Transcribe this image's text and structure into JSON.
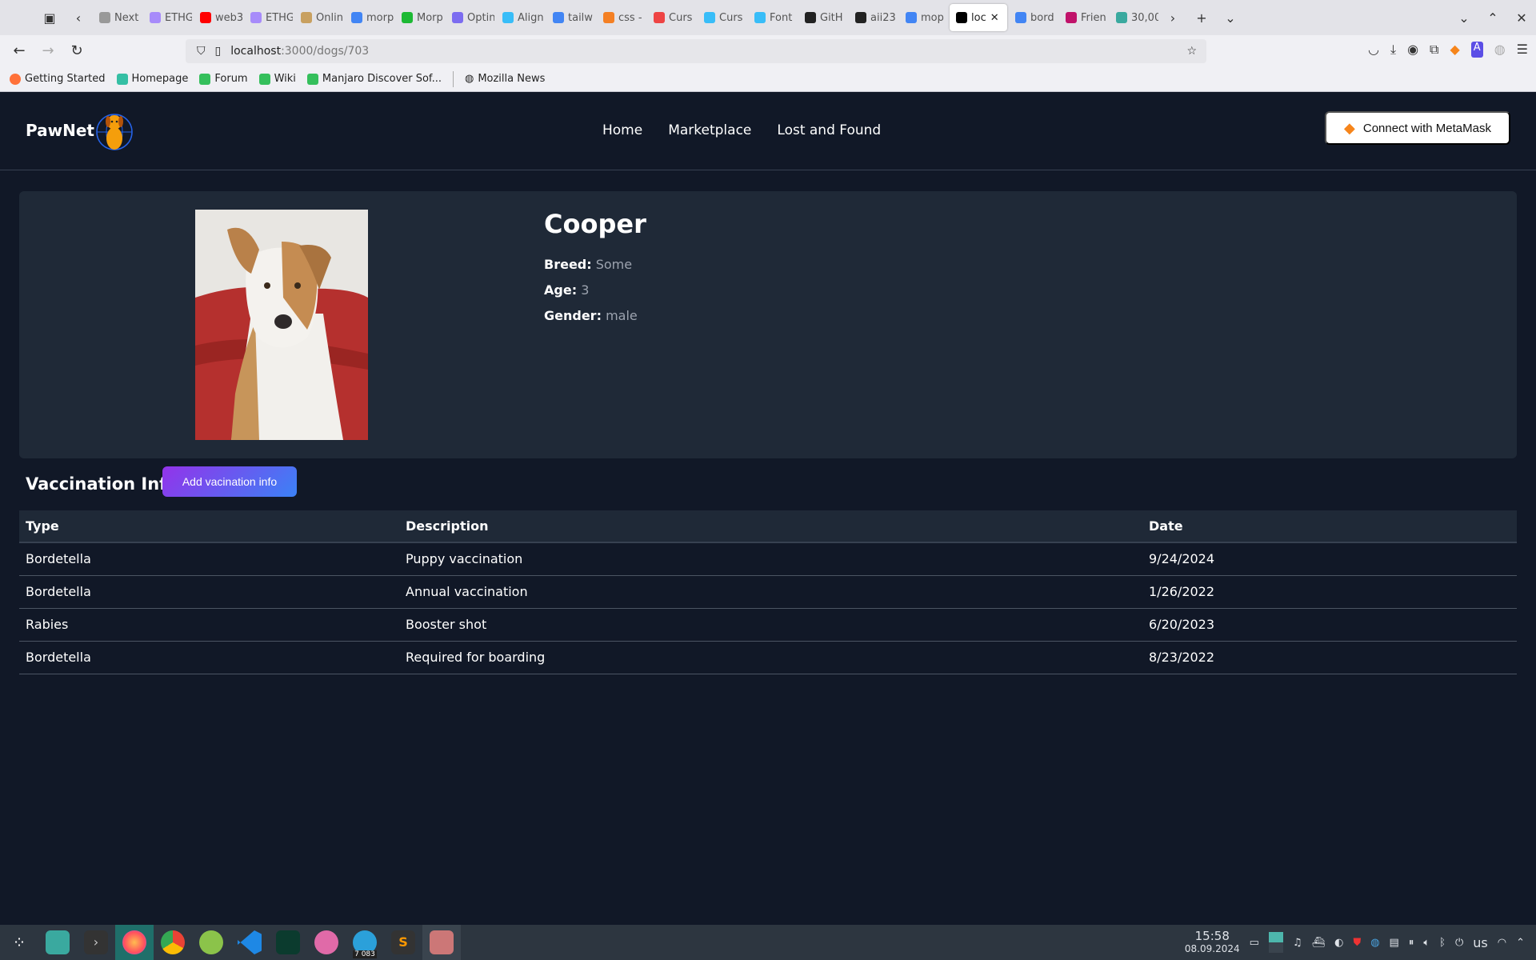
{
  "browser": {
    "tabs": [
      {
        "label": "Next",
        "color": "#999"
      },
      {
        "label": "ETHG",
        "color": "#a78bfa"
      },
      {
        "label": "web3",
        "color": "#ff0000"
      },
      {
        "label": "ETHG",
        "color": "#a78bfa"
      },
      {
        "label": "Onlin",
        "color": "#c8a060"
      },
      {
        "label": "morp",
        "color": "#4285f4"
      },
      {
        "label": "Morp",
        "color": "#1db934"
      },
      {
        "label": "Optin",
        "color": "#7c6cf0"
      },
      {
        "label": "Align",
        "color": "#38bdf8"
      },
      {
        "label": "tailw",
        "color": "#4285f4"
      },
      {
        "label": "css -",
        "color": "#f48024"
      },
      {
        "label": "Curs",
        "color": "#e44"
      },
      {
        "label": "Curs",
        "color": "#38bdf8"
      },
      {
        "label": "Font",
        "color": "#38bdf8"
      },
      {
        "label": "GitH",
        "color": "#222"
      },
      {
        "label": "aii23",
        "color": "#222"
      },
      {
        "label": "mop",
        "color": "#4285f4"
      },
      {
        "label": "loc",
        "color": "#000",
        "active": true
      },
      {
        "label": "bord",
        "color": "#4285f4"
      },
      {
        "label": "Frien",
        "color": "#c0126a"
      },
      {
        "label": "30,00",
        "color": "#3aa99f"
      }
    ],
    "url_host": "localhost",
    "url_path": ":3000/dogs/703",
    "bookmarks": [
      "Getting Started",
      "Homepage",
      "Forum",
      "Wiki",
      "Manjaro Discover Sof...",
      "Mozilla News"
    ]
  },
  "navbar": {
    "logo": "PawNet",
    "links": [
      "Home",
      "Marketplace",
      "Lost and Found"
    ],
    "connect_label": "Connect with MetaMask"
  },
  "dog": {
    "name": "Cooper",
    "breed_label": "Breed:",
    "breed": "Some",
    "age_label": "Age:",
    "age": "3",
    "gender_label": "Gender:",
    "gender": "male"
  },
  "vaccination": {
    "title": "Vaccination Info",
    "add_label": "Add vacination info",
    "columns": [
      "Type",
      "Description",
      "Date"
    ],
    "rows": [
      [
        "Bordetella",
        "Puppy vaccination",
        "9/24/2024"
      ],
      [
        "Bordetella",
        "Annual vaccination",
        "1/26/2022"
      ],
      [
        "Rabies",
        "Booster shot",
        "6/20/2023"
      ],
      [
        "Bordetella",
        "Required for boarding",
        "8/23/2022"
      ]
    ]
  },
  "taskbar": {
    "time": "15:58",
    "date": "08.09.2024",
    "badge": "7 083",
    "layout": "us"
  }
}
